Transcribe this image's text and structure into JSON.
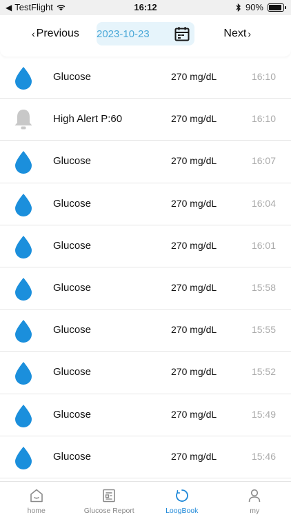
{
  "status_bar": {
    "carrier": "TestFlight",
    "time": "16:12",
    "battery": "90%",
    "battery_level": 0.9
  },
  "date_nav": {
    "previous_label": "Previous",
    "date": "2023-10-23",
    "next_label": "Next"
  },
  "entries": [
    {
      "type": "glucose",
      "icon": "blood-drop-icon",
      "label": "Glucose",
      "value": "270 mg/dL",
      "time": "16:10"
    },
    {
      "type": "alert",
      "icon": "bell-icon",
      "label": "High Alert P:60",
      "value": "270 mg/dL",
      "time": "16:10"
    },
    {
      "type": "glucose",
      "icon": "blood-drop-icon",
      "label": "Glucose",
      "value": "270 mg/dL",
      "time": "16:07"
    },
    {
      "type": "glucose",
      "icon": "blood-drop-icon",
      "label": "Glucose",
      "value": "270 mg/dL",
      "time": "16:04"
    },
    {
      "type": "glucose",
      "icon": "blood-drop-icon",
      "label": "Glucose",
      "value": "270 mg/dL",
      "time": "16:01"
    },
    {
      "type": "glucose",
      "icon": "blood-drop-icon",
      "label": "Glucose",
      "value": "270 mg/dL",
      "time": "15:58"
    },
    {
      "type": "glucose",
      "icon": "blood-drop-icon",
      "label": "Glucose",
      "value": "270 mg/dL",
      "time": "15:55"
    },
    {
      "type": "glucose",
      "icon": "blood-drop-icon",
      "label": "Glucose",
      "value": "270 mg/dL",
      "time": "15:52"
    },
    {
      "type": "glucose",
      "icon": "blood-drop-icon",
      "label": "Glucose",
      "value": "270 mg/dL",
      "time": "15:49"
    },
    {
      "type": "glucose",
      "icon": "blood-drop-icon",
      "label": "Glucose",
      "value": "270 mg/dL",
      "time": "15:46"
    }
  ],
  "tabs": [
    {
      "label": "home",
      "icon": "home-icon",
      "active": false
    },
    {
      "label": "Glucose Report",
      "icon": "report-icon",
      "active": false
    },
    {
      "label": "LoogBook",
      "icon": "logbook-icon",
      "active": true
    },
    {
      "label": "my",
      "icon": "person-icon",
      "active": false
    }
  ],
  "colors": {
    "accent": "#1e88d8",
    "drop": "#1b8fdc",
    "bell": "#c8c8c8",
    "date_pill_bg": "#e6f4fb",
    "date_text": "#4aa8d8",
    "time_text": "#aaaaaa"
  }
}
